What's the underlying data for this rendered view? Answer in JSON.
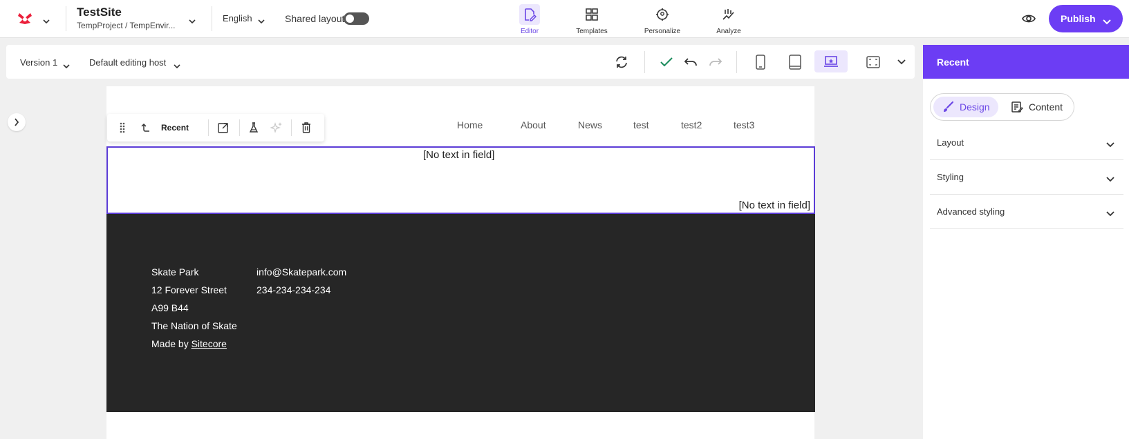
{
  "app": {
    "site_title": "TestSite",
    "site_subtitle": "TempProject / TempEnvir...",
    "language": "English",
    "shared_layout_label": "Shared layout",
    "nav": [
      {
        "label": "Editor",
        "icon": "editor-icon"
      },
      {
        "label": "Templates",
        "icon": "templates-icon"
      },
      {
        "label": "Personalize",
        "icon": "personalize-icon"
      },
      {
        "label": "Analyze",
        "icon": "analyze-icon"
      }
    ],
    "publish_label": "Publish",
    "accent_color": "#6c3df4"
  },
  "toolbar": {
    "version": "Version 1",
    "editing_host": "Default editing host"
  },
  "floating_toolbar": {
    "label": "Recent"
  },
  "page": {
    "nav_links": [
      "Home",
      "About",
      "News",
      "test",
      "test2",
      "test3"
    ],
    "placeholder_top": "[No text in field]",
    "placeholder_bottom": "[No text in field]",
    "footer": {
      "col1": [
        "Skate Park",
        "12 Forever Street",
        "A99 B44",
        "The Nation of Skate"
      ],
      "made_by_prefix": "Made by",
      "made_by_link": "Sitecore",
      "col2": [
        "info@Skatepark.com",
        "234-234-234-234"
      ]
    }
  },
  "right_panel": {
    "title": "Recent",
    "tabs": [
      "Design",
      "Content"
    ],
    "sections": [
      "Layout",
      "Styling",
      "Advanced styling"
    ]
  }
}
